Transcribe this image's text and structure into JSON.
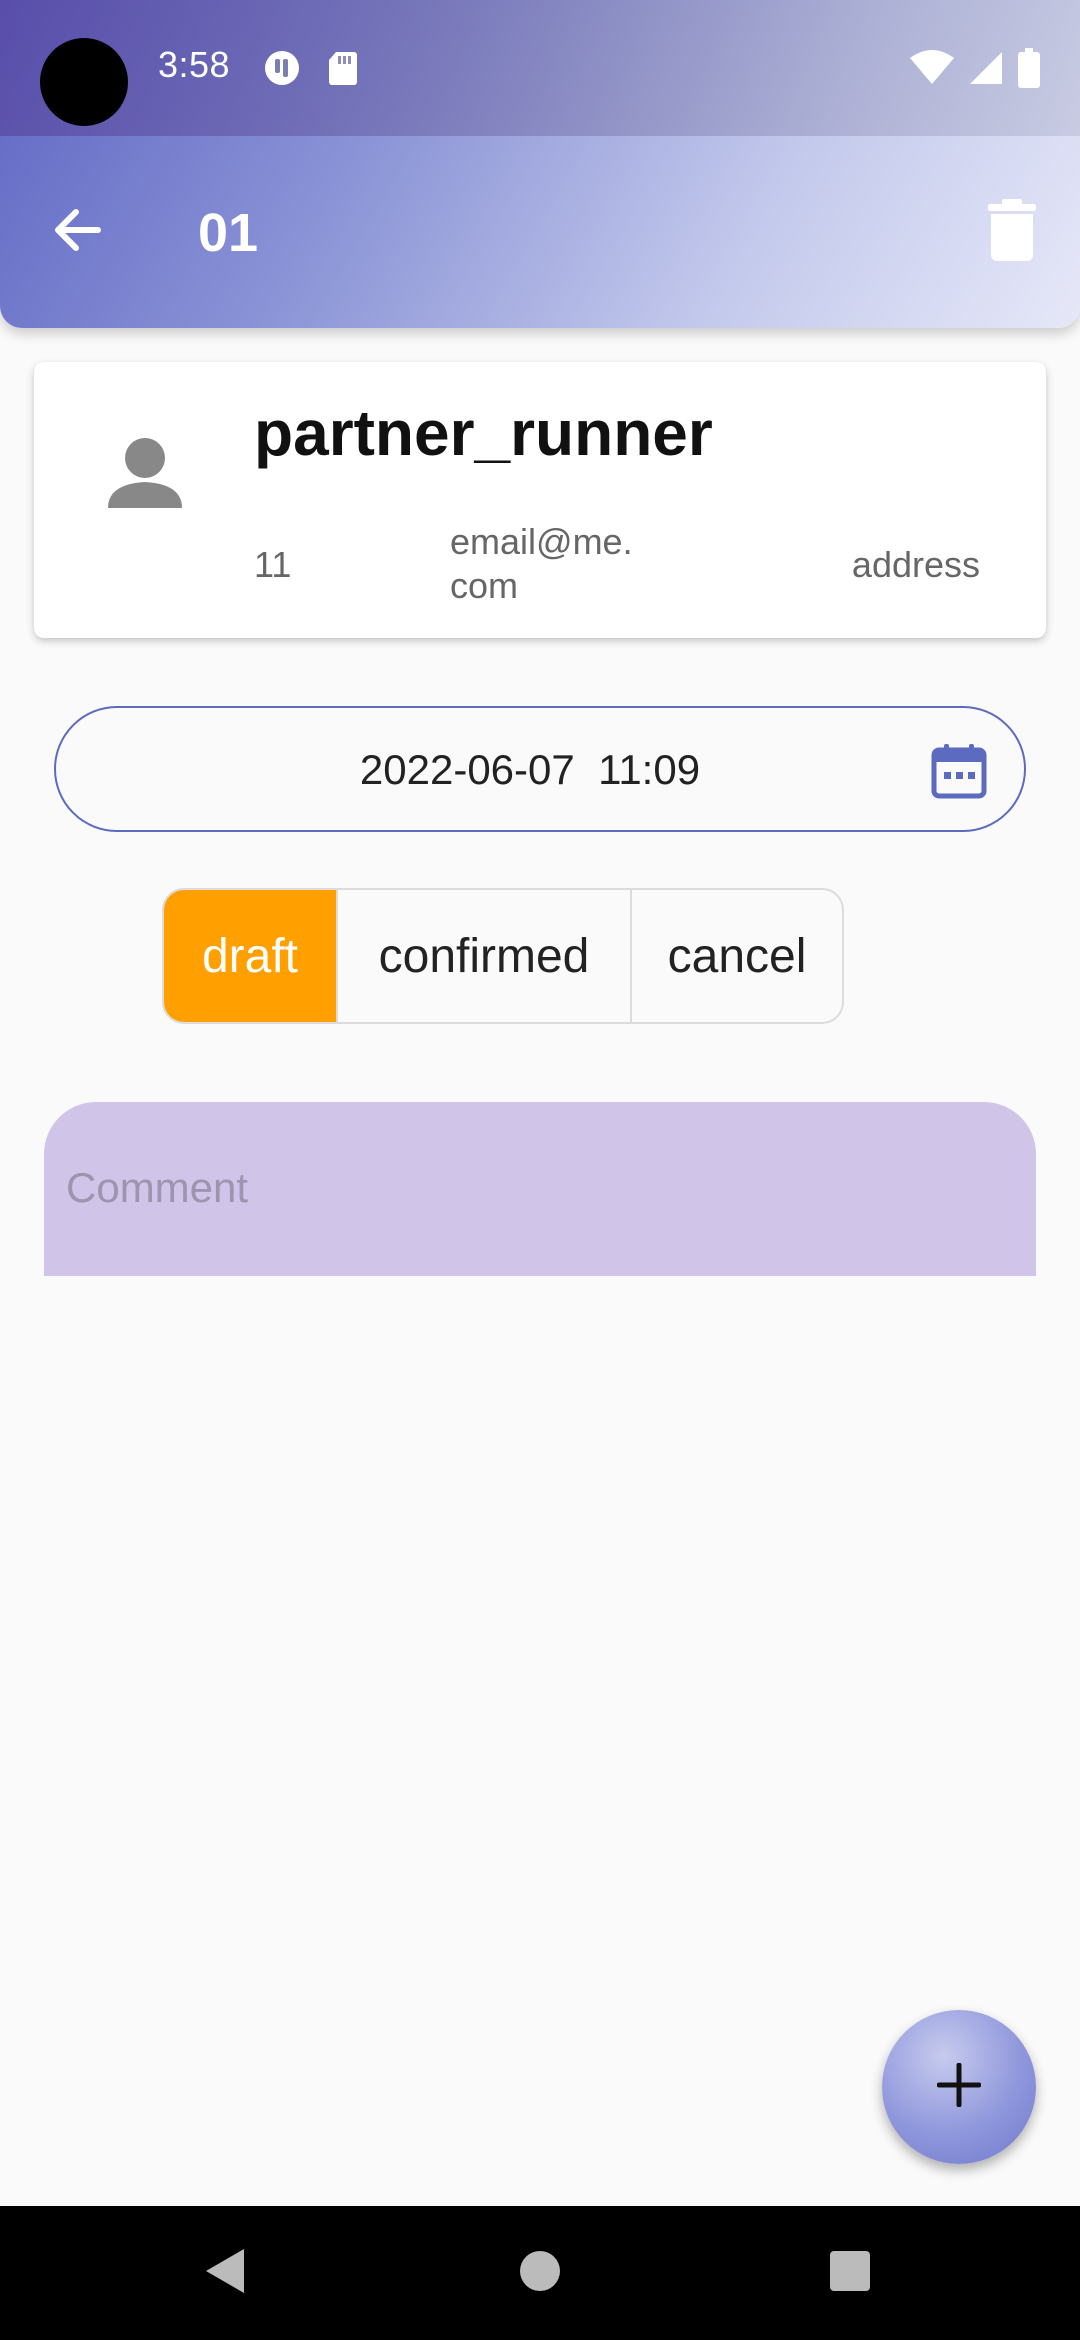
{
  "status_bar": {
    "time": "3:58",
    "icons_left": [
      "data-saver-icon",
      "sd-card-icon"
    ],
    "icons_right": [
      "wifi-icon",
      "signal-icon",
      "battery-icon"
    ]
  },
  "app_bar": {
    "title": "01",
    "back_icon": "arrow-back-icon",
    "delete_icon": "trash-icon"
  },
  "partner": {
    "name": "partner_runner",
    "phone": "11",
    "email": "email@me.com",
    "address": "address",
    "avatar_icon": "person-icon"
  },
  "date_field": {
    "value": "2022-06-07  11:09",
    "icon": "calendar-icon"
  },
  "state_selector": {
    "options": [
      "draft",
      "confirmed",
      "cancel"
    ],
    "selected": "draft"
  },
  "comment": {
    "placeholder": "Comment",
    "value": ""
  },
  "fab": {
    "icon": "plus-icon"
  },
  "colors": {
    "primary": "#5c6bc0",
    "selected_state": "#ffa000",
    "comment_fill": "#d1c4e9",
    "nav_bar": "#000000"
  }
}
